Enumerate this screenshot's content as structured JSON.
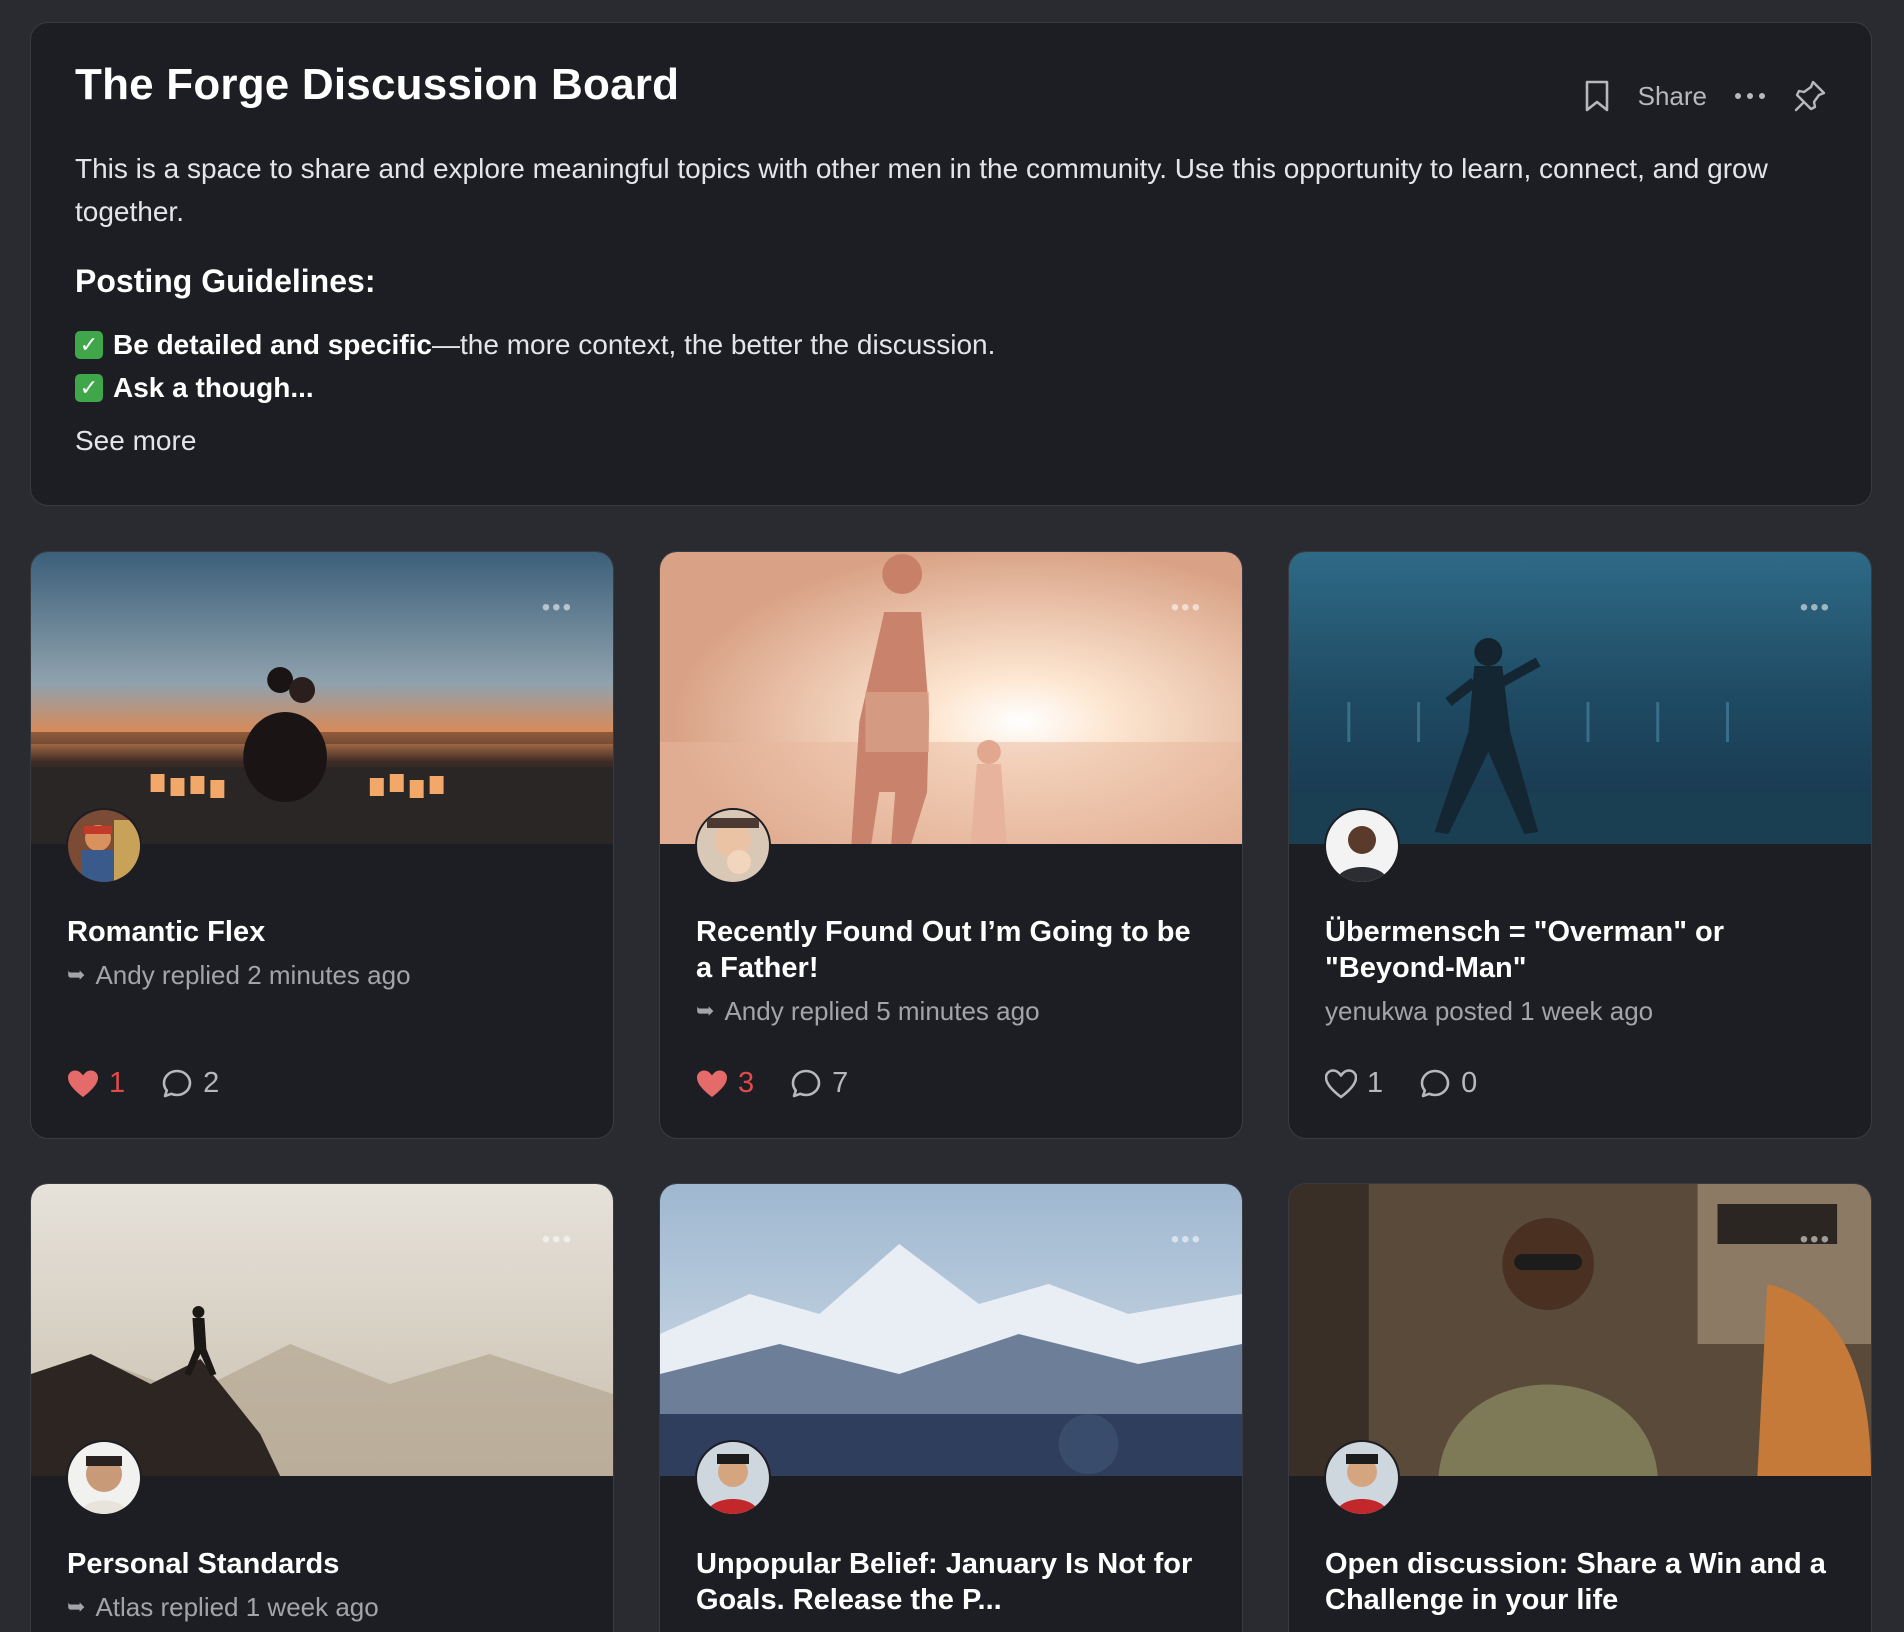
{
  "board": {
    "title": "The Forge Discussion Board",
    "share_label": "Share",
    "description": "This is a space to share and explore meaningful topics with other men in the community. Use this opportunity to learn, connect, and grow together.",
    "guidelines_title": "Posting Guidelines:",
    "guideline_1_bold": "Be detailed and specific",
    "guideline_1_rest": "—the more context, the better the discussion.",
    "guideline_2_bold": "Ask a though...",
    "see_more": "See more",
    "icons": [
      "bookmark-icon",
      "more-icon",
      "pin-icon",
      "check-icon"
    ]
  },
  "posts": [
    {
      "title": "Romantic Flex",
      "meta": "Andy replied 2 minutes ago",
      "replied": true,
      "likes": "1",
      "liked": true,
      "comments": "2"
    },
    {
      "title": "Recently Found Out I’m Going to be a Father!",
      "meta": "Andy replied 5 minutes ago",
      "replied": true,
      "likes": "3",
      "liked": true,
      "comments": "7"
    },
    {
      "title": "Übermensch = \"Overman\" or \"Beyond-Man\"",
      "meta": "yenukwa posted 1 week ago",
      "replied": false,
      "likes": "1",
      "liked": false,
      "comments": "0"
    },
    {
      "title": "Personal Standards",
      "meta": "Atlas replied 1 week ago",
      "replied": true
    },
    {
      "title": "Unpopular Belief: January Is Not for Goals. Release the P...",
      "meta": "",
      "replied": false
    },
    {
      "title": "Open discussion: Share a Win and a Challenge in your life",
      "meta": "",
      "replied": false
    }
  ],
  "colors": {
    "background": "#2a2b30",
    "card": "#1d1e23",
    "like_active": "#e04a4a",
    "check": "#3fa74a"
  }
}
